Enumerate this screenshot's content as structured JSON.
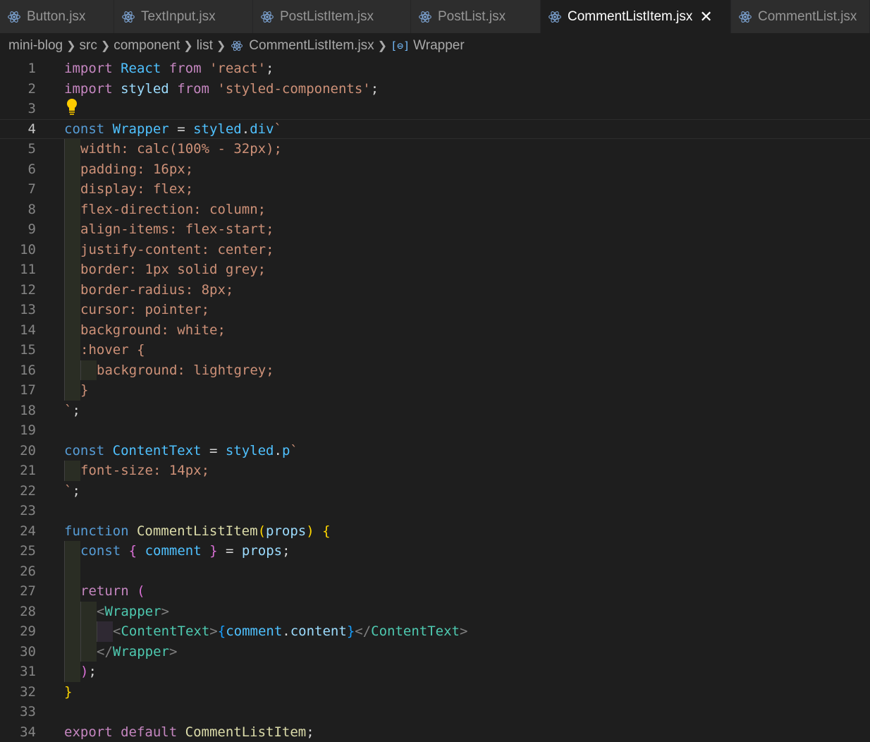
{
  "tabs": [
    {
      "label": "Button.jsx",
      "active": false
    },
    {
      "label": "TextInput.jsx",
      "active": false
    },
    {
      "label": "PostListItem.jsx",
      "active": false
    },
    {
      "label": "PostList.jsx",
      "active": false
    },
    {
      "label": "CommentListItem.jsx",
      "active": true
    },
    {
      "label": "CommentList.jsx",
      "active": false
    }
  ],
  "breadcrumb": {
    "items": [
      "mini-blog",
      "src",
      "component",
      "list",
      "CommentListItem.jsx"
    ],
    "symbol": "Wrapper"
  },
  "editor": {
    "current_line": 4,
    "line_numbers": [
      "1",
      "2",
      "3",
      "4",
      "5",
      "6",
      "7",
      "8",
      "9",
      "10",
      "11",
      "12",
      "13",
      "14",
      "15",
      "16",
      "17",
      "18",
      "19",
      "20",
      "21",
      "22",
      "23",
      "24",
      "25",
      "26",
      "27",
      "28",
      "29",
      "30",
      "31",
      "32",
      "33",
      "34"
    ],
    "lines": [
      "import React from 'react';",
      "import styled from 'styled-components';",
      "",
      "const Wrapper = styled.div`",
      "  width: calc(100% - 32px);",
      "  padding: 16px;",
      "  display: flex;",
      "  flex-direction: column;",
      "  align-items: flex-start;",
      "  justify-content: center;",
      "  border: 1px solid grey;",
      "  border-radius: 8px;",
      "  cursor: pointer;",
      "  background: white;",
      "  :hover {",
      "    background: lightgrey;",
      "  }",
      "`;",
      "",
      "const ContentText = styled.p`",
      "  font-size: 14px;",
      "`;",
      "",
      "function CommentListItem(props) {",
      "  const { comment } = props;",
      "",
      "  return (",
      "    <Wrapper>",
      "      <ContentText>{comment.content}</ContentText>",
      "    </Wrapper>",
      "  );",
      "}",
      "",
      "export default CommentListItem;"
    ]
  },
  "colors": {
    "background": "#1e1e1e",
    "keyword_control": "#c586c0",
    "keyword_storage": "#569cd6",
    "string": "#ce9178",
    "function": "#dcdcaa",
    "component_tag": "#4ec9b0",
    "constant": "#4fc1ff",
    "lightbulb": "#ffcc00"
  },
  "icons": {
    "tab_file_icon": "react-icon",
    "breadcrumb_file_icon": "react-icon",
    "breadcrumb_symbol_icon": "symbol-variable-icon",
    "lightbulb": "lightbulb-icon",
    "close": "close-icon"
  }
}
